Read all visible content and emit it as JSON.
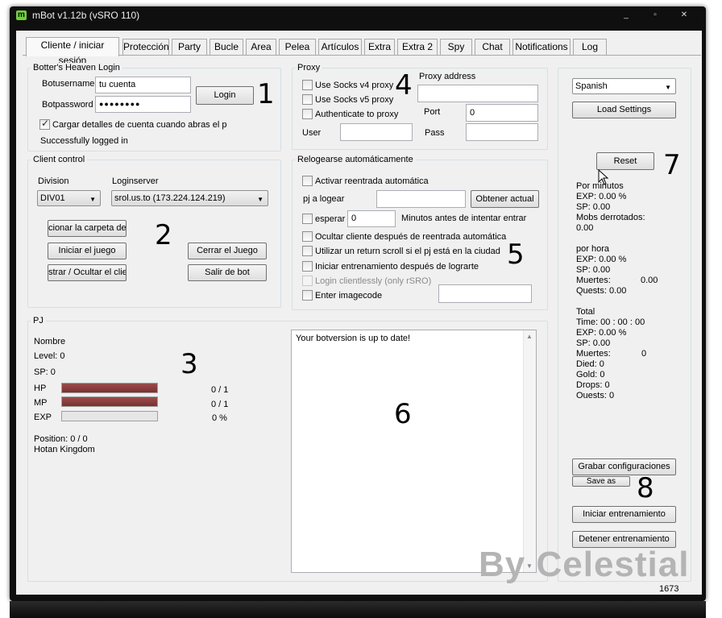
{
  "window": {
    "title": "mBot v1.12b (vSRO 110)",
    "controls": [
      "_",
      "▫",
      "✕"
    ]
  },
  "tabs": [
    "Cliente / iniciar sesión",
    "Protección",
    "Party",
    "Bucle",
    "Area",
    "Pelea",
    "Artículos",
    "Extra",
    "Extra 2",
    "Spy",
    "Chat",
    "Notifications",
    "Log"
  ],
  "login": {
    "group_title": "Botter's Heaven Login",
    "username_label": "Botusername",
    "username_value": "tu cuenta",
    "password_label": "Botpassword",
    "password_value": "●●●●●●●●",
    "login_button": "Login",
    "remember_label": "Cargar detalles de cuenta cuando abras el p",
    "status": "Successfully logged in"
  },
  "client": {
    "group_title": "Client control",
    "division_label": "Division",
    "division_value": "DIV01",
    "loginserver_label": "Loginserver",
    "loginserver_value": "srol.us.to (173.224.124.219)",
    "btn_select_folder": "cionar la carpeta de",
    "btn_start_game": "Iniciar el juego",
    "btn_show_hide": "strar / Ocultar el clie",
    "btn_close_game": "Cerrar el Juego",
    "btn_exit_bot": "Salir de bot"
  },
  "proxy": {
    "group_title": "Proxy",
    "socks4": "Use Socks v4 proxy",
    "socks5": "Use Socks v5 proxy",
    "auth": "Authenticate to proxy",
    "address_label": "Proxy address",
    "port_label": "Port",
    "port_value": "0",
    "user_label": "User",
    "pass_label": "Pass"
  },
  "relog": {
    "group_title": "Relogearse automáticamente",
    "activate": "Activar reentrada automática",
    "char_label": "pj a logear",
    "get_current_button": "Obtener actual",
    "wait_label": "esperar",
    "wait_value": "0",
    "wait_suffix": "Minutos antes de intentar entrar",
    "hide_client": "Ocultar cliente después de reentrada automática",
    "return_scroll": "Utilizar un return scroll si el pj está en la ciudad",
    "start_training": "Iniciar entrenamiento después de lograrte",
    "clientless": "Login clientlessly (only rSRO)",
    "imagecode": "Enter imagecode"
  },
  "character": {
    "group_title": "PJ",
    "name": "Nombre",
    "level": "Level: 0",
    "sp": "SP: 0",
    "hp_label": "HP",
    "hp_value": "0 / 1",
    "hp_fill": 1.0,
    "mp_label": "MP",
    "mp_value": "0 / 1",
    "mp_fill": 1.0,
    "exp_label": "EXP",
    "exp_value": "0 %",
    "exp_fill": 0.0,
    "position": "Position: 0 / 0",
    "location": "Hotan Kingdom"
  },
  "log": {
    "text": "Your botversion is up to date!"
  },
  "side": {
    "language": "Spanish",
    "load_settings": "Load Settings",
    "reset": "Reset",
    "per_minute_title": "Por minutos",
    "pm_exp": "EXP:     0.00 %",
    "pm_sp": "SP:        0.00",
    "pm_mobs": "Mobs derrotados:",
    "pm_mobs_val": "0.00",
    "per_hour_title": "por hora",
    "ph_exp": "EXP:     0.00 %",
    "ph_sp": "SP:        0.00",
    "ph_deaths": "Muertes:",
    "ph_deaths_val": "0.00",
    "ph_quests": "Quests: 0.00",
    "total_title": "Total",
    "t_time": "Time:     00 : 00 : 00",
    "t_exp": "EXP:     0.00 %",
    "t_sp": "SP:        0.00",
    "t_deaths": "Muertes:",
    "t_deaths_val": "0",
    "t_died": "Died:      0",
    "t_gold": "Gold:      0",
    "t_drops": "Drops:    0",
    "t_quests": "Ouests: 0",
    "save_config": "Grabar configuraciones",
    "save_as": "Save as",
    "start_training": "Iniciar entrenamiento",
    "stop_training": "Detener entrenamiento"
  },
  "annotations": {
    "n1": "1",
    "n2": "2",
    "n3": "3",
    "n4": "4",
    "n5": "5",
    "n6": "6",
    "n7": "7",
    "n8": "8"
  },
  "watermark": "By Celestial",
  "footer_count": "1673"
}
